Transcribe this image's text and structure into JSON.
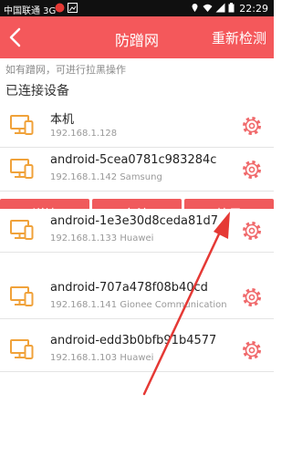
{
  "status_bar": {
    "carrier": "中国联通 3G",
    "time": "22:29"
  },
  "header": {
    "title": "防蹭网",
    "recheck_label": "重新检测"
  },
  "hint": "如有蹭网，可进行拉黑操作",
  "section_title": "已连接设备",
  "devices": [
    {
      "name": "本机",
      "info": "192.168.1.128"
    },
    {
      "name": "android-5cea0781c983284c",
      "info": "192.168.1.142  Samsung"
    },
    {
      "name": "android-1e3e30d8ceda81d7",
      "info": "192.168.1.133  Huawei"
    },
    {
      "name": "android-707a478f08b40cd",
      "info": "192.168.1.141  Gionee Communication"
    },
    {
      "name": "android-edd3b0bfb91b4577",
      "info": "192.168.1.103  Huawei"
    }
  ],
  "actions": {
    "details": "详情",
    "note": "备注",
    "block": "拉黑"
  },
  "colors": {
    "accent": "#f4585b",
    "device_icon": "#f0a23a",
    "gear": "#f06a6c",
    "annotation": "#e53935"
  }
}
